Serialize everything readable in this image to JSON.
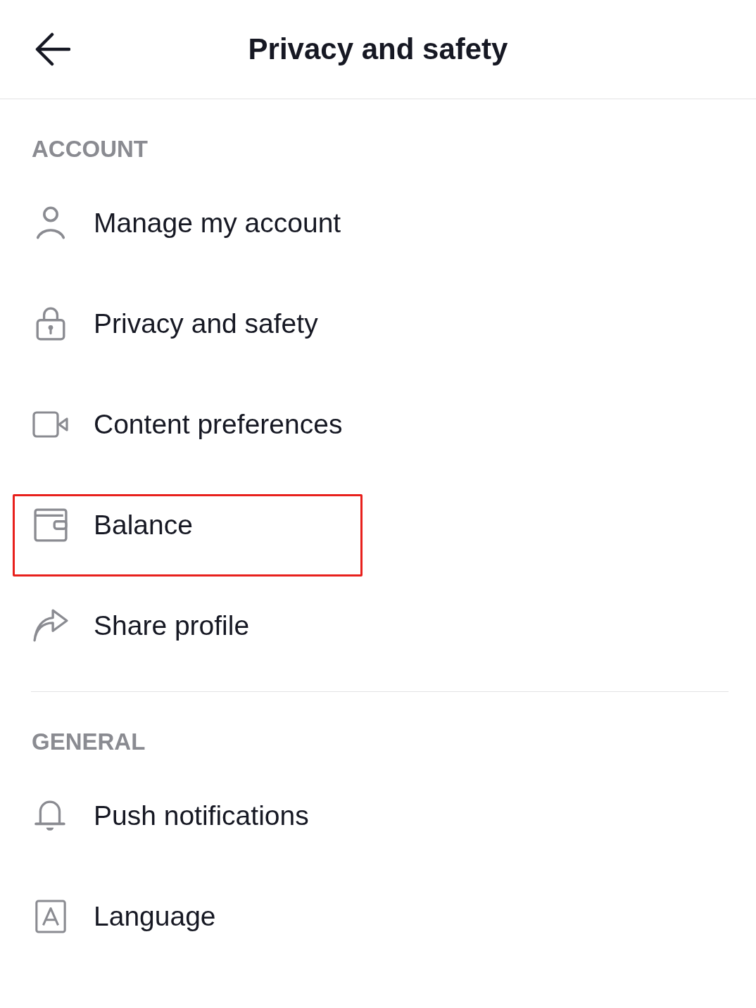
{
  "header": {
    "title": "Privacy and safety"
  },
  "sections": [
    {
      "heading": "ACCOUNT",
      "items": [
        {
          "kind": "person",
          "label": "Manage my account",
          "highlighted": false
        },
        {
          "kind": "lock",
          "label": "Privacy and safety",
          "highlighted": false
        },
        {
          "kind": "video",
          "label": "Content preferences",
          "highlighted": false
        },
        {
          "kind": "wallet",
          "label": "Balance",
          "highlighted": true
        },
        {
          "kind": "share",
          "label": "Share profile",
          "highlighted": false
        }
      ]
    },
    {
      "heading": "GENERAL",
      "items": [
        {
          "kind": "bell",
          "label": "Push notifications",
          "highlighted": false
        },
        {
          "kind": "language",
          "label": "Language",
          "highlighted": false
        }
      ]
    }
  ]
}
